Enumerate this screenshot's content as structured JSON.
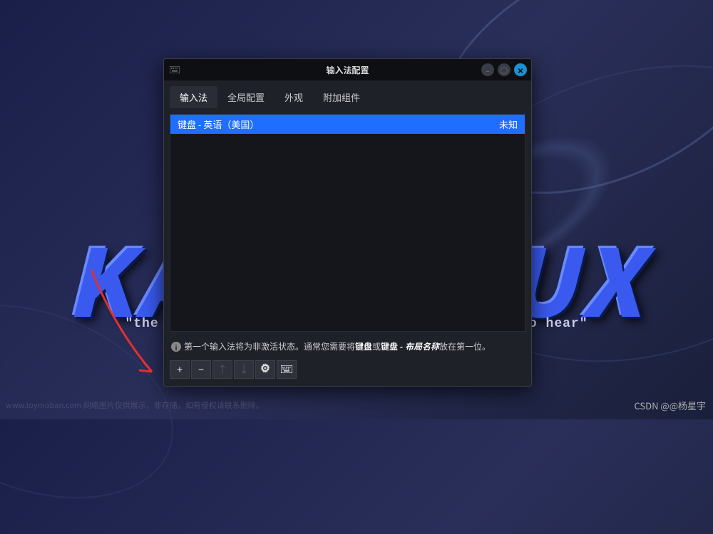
{
  "background": {
    "brand_text": "KALI LINUX",
    "subtitle": "\"the quieter you become, the more you are able to hear\""
  },
  "dialog": {
    "title": "输入法配置",
    "tabs": [
      {
        "label": "输入法",
        "active": true
      },
      {
        "label": "全局配置",
        "active": false
      },
      {
        "label": "外观",
        "active": false
      },
      {
        "label": "附加组件",
        "active": false
      }
    ],
    "list": [
      {
        "name": "键盘 - 英语（美国）",
        "status": "未知",
        "selected": true
      }
    ],
    "info": {
      "prefix": "第一个输入法将为非激活状态。通常您需要将",
      "bold1": "键盘",
      "mid": "或",
      "bold2": "键盘 - ",
      "italic": "布局名称",
      "suffix": "放在第一位。"
    },
    "toolbar": {
      "add": "+",
      "remove": "−",
      "up": "↑",
      "down": "↓",
      "settings_icon": "gear",
      "keyboard_icon": "keyboard"
    }
  },
  "watermarks": {
    "bottom_left": "www.toymoban.com 网络图片仅供展示，非存储，如有侵权请联系删除。",
    "bottom_right": "CSDN @@杨星宇"
  }
}
